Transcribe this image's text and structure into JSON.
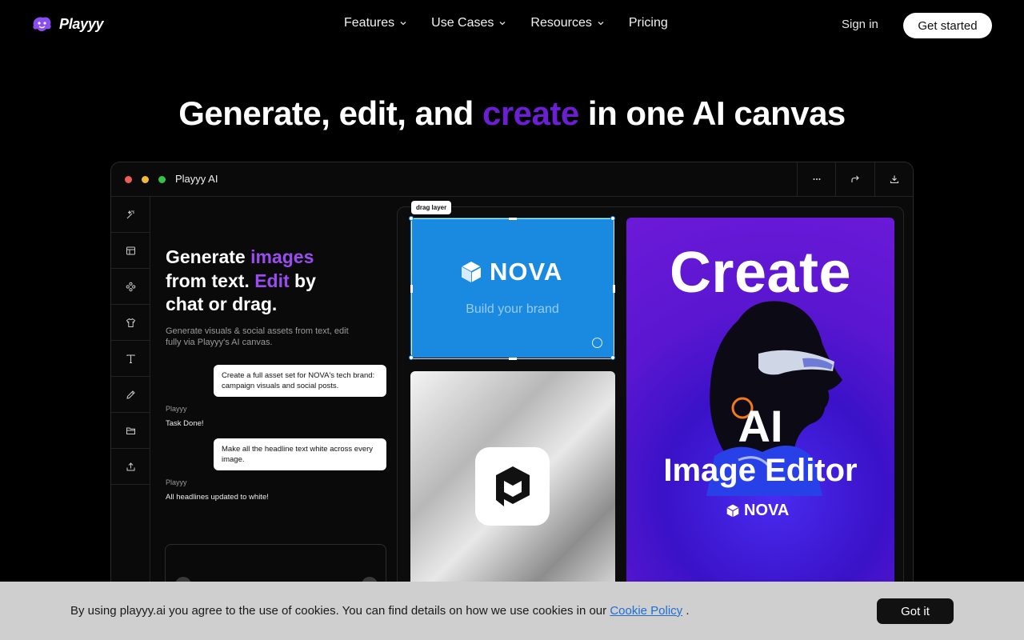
{
  "brand": {
    "name": "Playyy"
  },
  "nav": {
    "items": [
      {
        "label": "Features",
        "has_dropdown": true
      },
      {
        "label": "Use Cases",
        "has_dropdown": true
      },
      {
        "label": "Resources",
        "has_dropdown": true
      },
      {
        "label": "Pricing",
        "has_dropdown": false
      }
    ],
    "sign_in": "Sign in",
    "get_started": "Get started"
  },
  "hero": {
    "title_before": "Generate, edit, and",
    "title_accent": "create",
    "title_after": "in one AI canvas",
    "accent_color": "#6a1fd0"
  },
  "app_window": {
    "title": "Playyy AI",
    "titlebar_buttons": [
      "more-icon",
      "share-icon",
      "download-icon"
    ],
    "tools": [
      "magic-wand-icon",
      "layout-icon",
      "components-icon",
      "shirt-icon",
      "text-icon",
      "pen-icon",
      "folder-icon",
      "upload-icon"
    ],
    "panel": {
      "heading_1": "Generate",
      "heading_accent_1": "images",
      "heading_2": "from text.",
      "heading_accent_2": "Edit",
      "heading_3": "by",
      "heading_4": "chat or drag.",
      "subtitle": "Generate visuals & social assets from text, edit fully via Playyy's AI canvas.",
      "chat": [
        {
          "role": "user",
          "text": "Create a full asset set for NOVA's tech brand: campaign visuals and social posts."
        },
        {
          "role": "bot",
          "name": "Playyy",
          "text": "Task Done!"
        },
        {
          "role": "user",
          "text": "Make all the headline text white across every image."
        },
        {
          "role": "bot",
          "name": "Playyy",
          "text": "All headlines updated to white!"
        }
      ]
    },
    "canvas": {
      "drag_tag": "drag layer",
      "blue_tile": {
        "brand": "NOVA",
        "tagline": "Build your brand",
        "color": "#1a8ae0"
      },
      "purple_tile": {
        "headline": "Create",
        "ai": "AI",
        "subtitle": "Image Editor",
        "brand": "NOVA"
      }
    }
  },
  "cookie": {
    "text_before": "By using playyy.ai you agree to the use of cookies. You can find details on how we use cookies in our",
    "link": "Cookie Policy",
    "text_after": ".",
    "button": "Got it"
  }
}
